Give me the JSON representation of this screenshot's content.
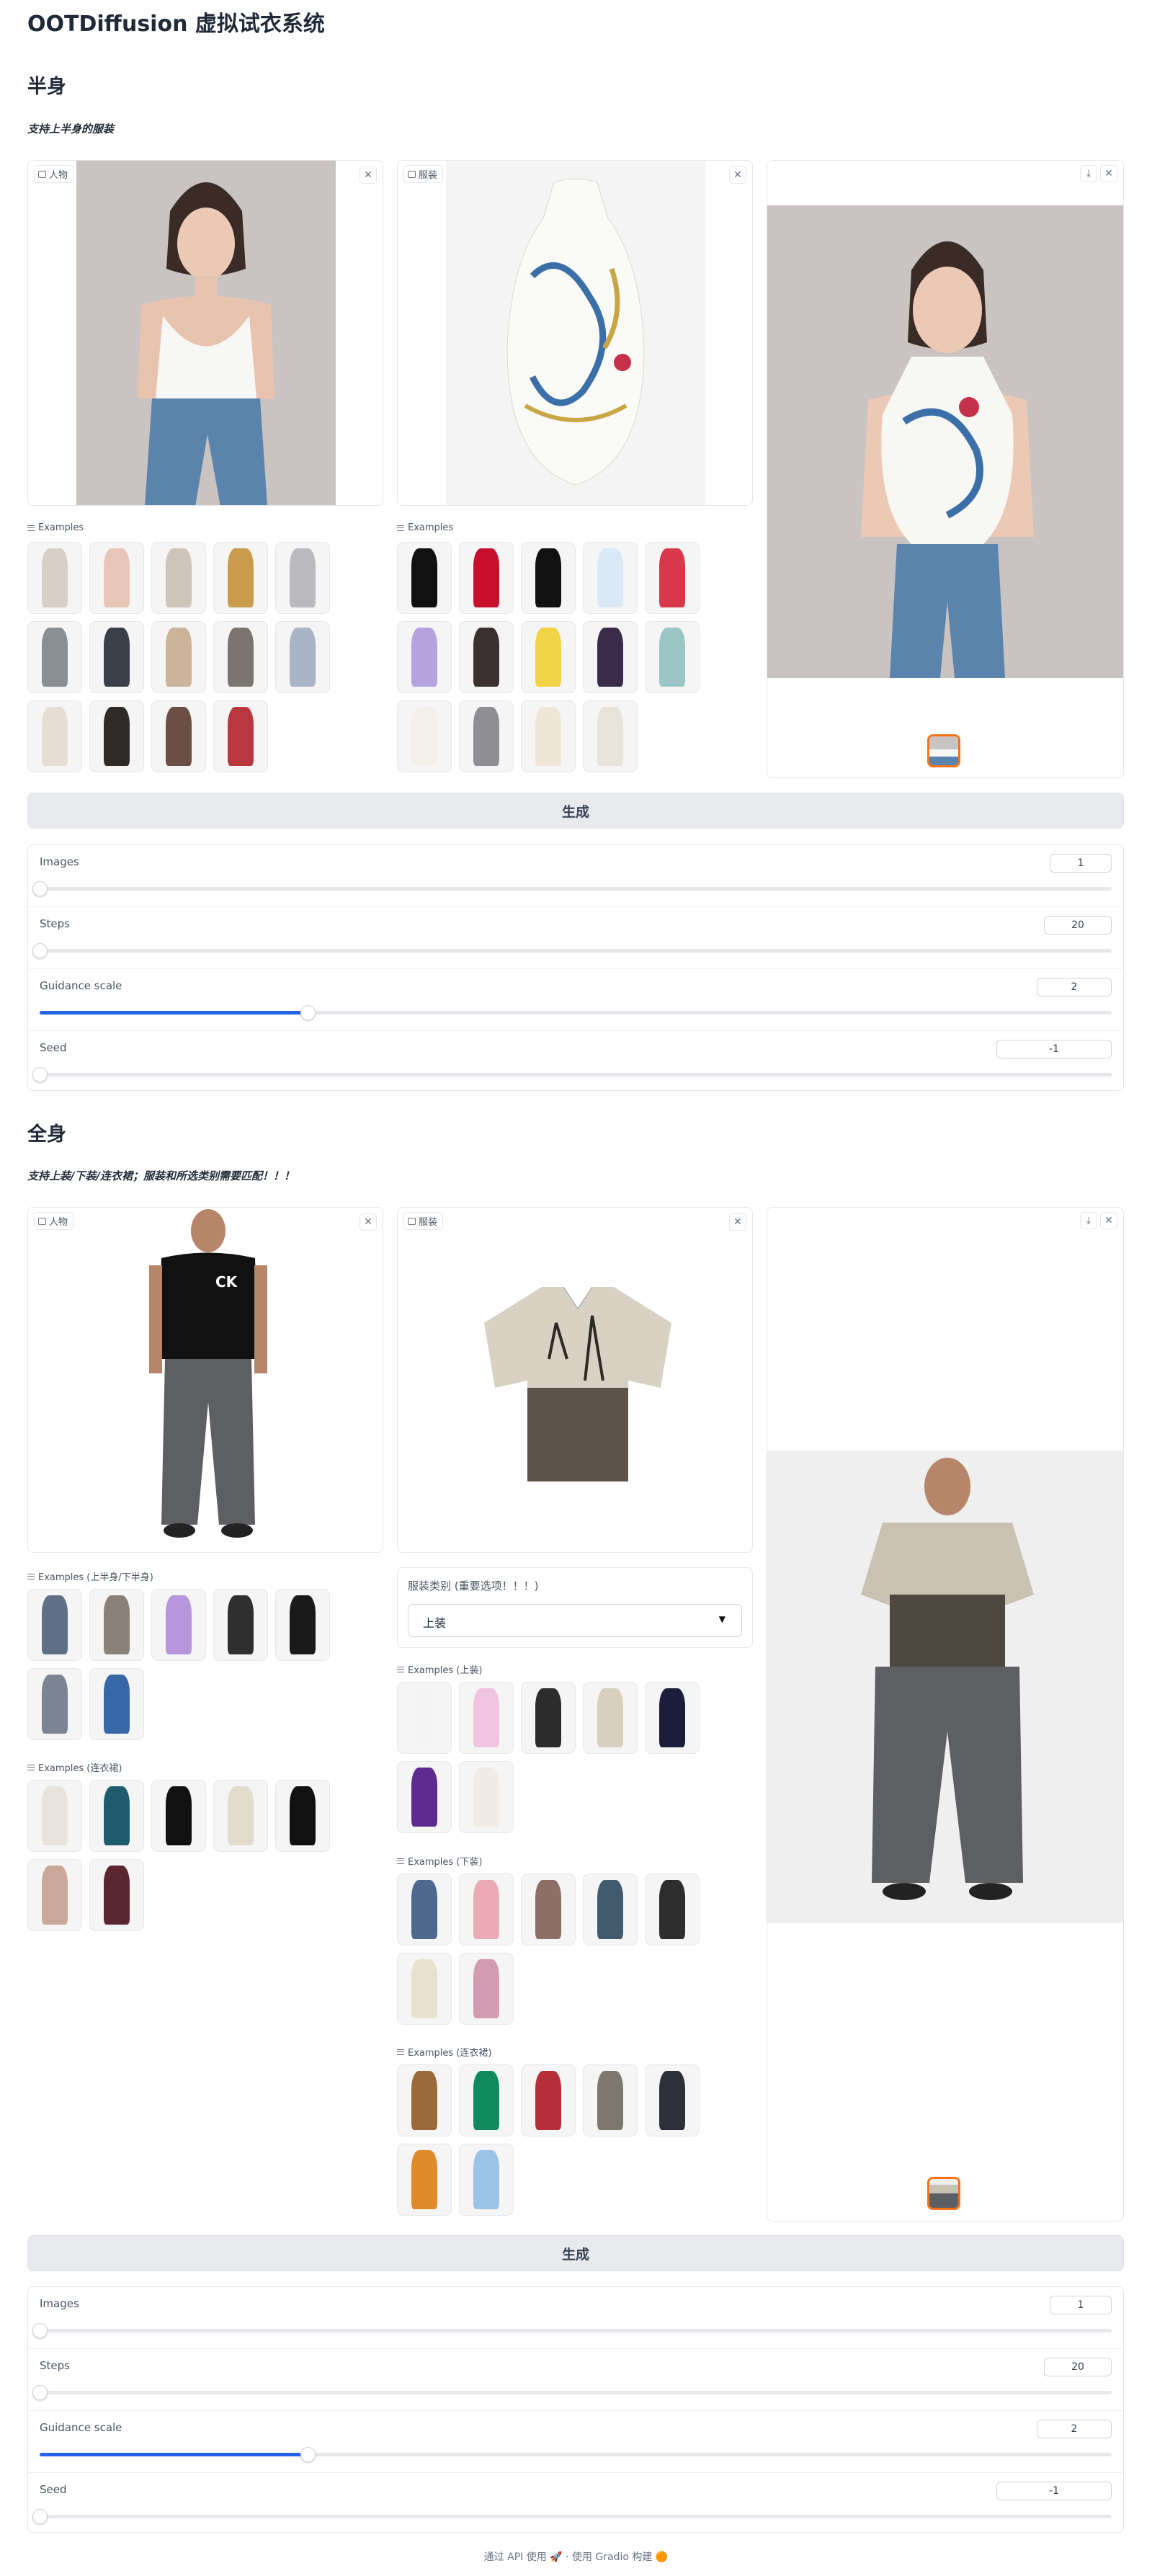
{
  "app_title": "OOTDiffusion 虚拟试衣系统",
  "sections": [
    {
      "title": "半身",
      "subtitle": "支持上半身的服装",
      "person_label": "人物",
      "garment_label": "服装",
      "person_examples_label": "Examples",
      "garment_examples_label": "Examples",
      "generate_label": "生成",
      "sliders": [
        {
          "label": "Images",
          "value": "1",
          "fraction": 0
        },
        {
          "label": "Steps",
          "value": "20",
          "fraction": 0
        },
        {
          "label": "Guidance scale",
          "value": "2",
          "fraction": 0.25
        },
        {
          "label": "Seed",
          "value": "-1",
          "fraction": 0
        }
      ]
    },
    {
      "title": "全身",
      "subtitle": "支持上装/下装/连衣裙；服装和所选类别需要匹配！！！",
      "person_label": "人物",
      "garment_label": "服装",
      "person_examples_upper_label": "Examples (上半身/下半身)",
      "person_examples_dress_label": "Examples (连衣裙)",
      "category_label": "服装类别 (重要选项！！！)",
      "category_value": "上装",
      "garment_examples_upper_label": "Examples (上装)",
      "garment_examples_lower_label": "Examples (下装)",
      "garment_examples_dress_label": "Examples (连衣裙)",
      "generate_label": "生成",
      "sliders": [
        {
          "label": "Images",
          "value": "1",
          "fraction": 0
        },
        {
          "label": "Steps",
          "value": "20",
          "fraction": 0
        },
        {
          "label": "Guidance scale",
          "value": "2",
          "fraction": 0.25
        },
        {
          "label": "Seed",
          "value": "-1",
          "fraction": 0
        }
      ]
    }
  ],
  "footer": {
    "api": "通过 API 使用",
    "built": "使用 Gradio 构建",
    "sep": "·"
  },
  "colors": {
    "accent": "#2563eb",
    "selected": "#f97316",
    "button_bg": "#e8eaee"
  }
}
